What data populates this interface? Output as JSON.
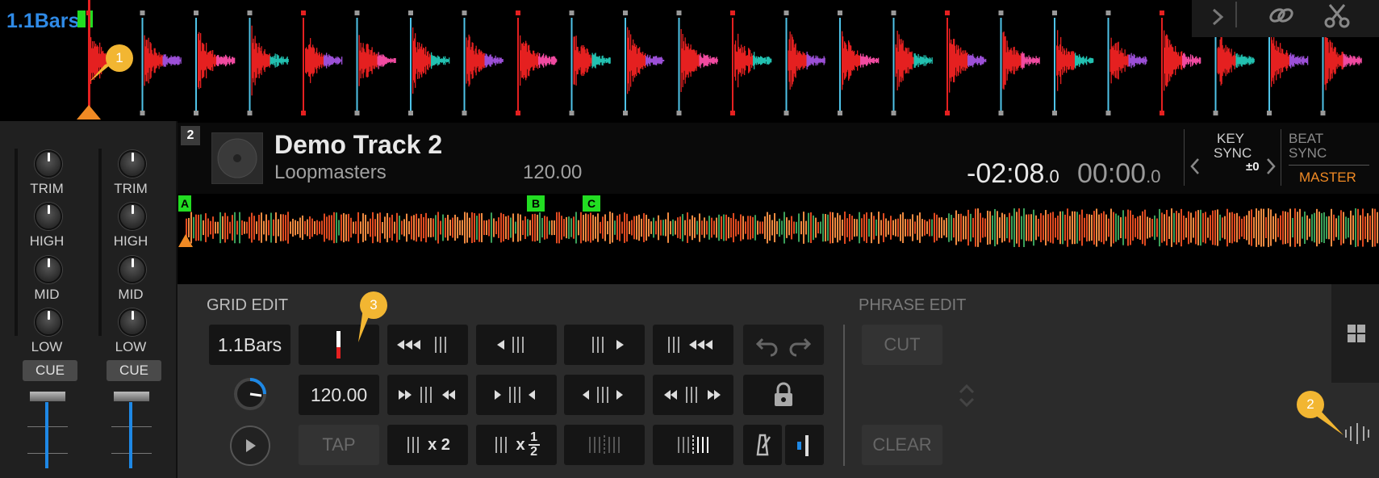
{
  "top_waveform": {
    "bars_label": "1.1Bars"
  },
  "mixer": {
    "channels": [
      {
        "trim": "TRIM",
        "high": "HIGH",
        "mid": "MID",
        "low": "LOW",
        "cue": "CUE"
      },
      {
        "trim": "TRIM",
        "high": "HIGH",
        "mid": "MID",
        "low": "LOW",
        "cue": "CUE"
      }
    ]
  },
  "deck": {
    "number": "2",
    "title": "Demo Track 2",
    "artist": "Loopmasters",
    "bpm": "120.00",
    "time_remaining": "-02:08",
    "time_remaining_dec": ".0",
    "time_elapsed": "00:00",
    "time_elapsed_dec": ".0",
    "key_sync": {
      "label1": "KEY",
      "label2": "SYNC",
      "value": "±0"
    },
    "beat_sync": {
      "label1": "BEAT",
      "label2": "SYNC",
      "master": "MASTER"
    },
    "hot_cues": [
      "A",
      "B",
      "C"
    ]
  },
  "grid_edit": {
    "label": "GRID EDIT",
    "bars_display": "1.1Bars",
    "bpm_value": "120.00",
    "tap": "TAP",
    "x2_label": "x 2",
    "half_num": "1",
    "half_den": "2"
  },
  "phrase_edit": {
    "label": "PHRASE EDIT",
    "cut": "CUT",
    "clear": "CLEAR"
  },
  "callouts": [
    "1",
    "2",
    "3"
  ],
  "colors": {
    "accent_blue": "#1e88e5",
    "master_orange": "#f08a24",
    "callout": "#f2b632",
    "cue_green": "#22dd22"
  }
}
